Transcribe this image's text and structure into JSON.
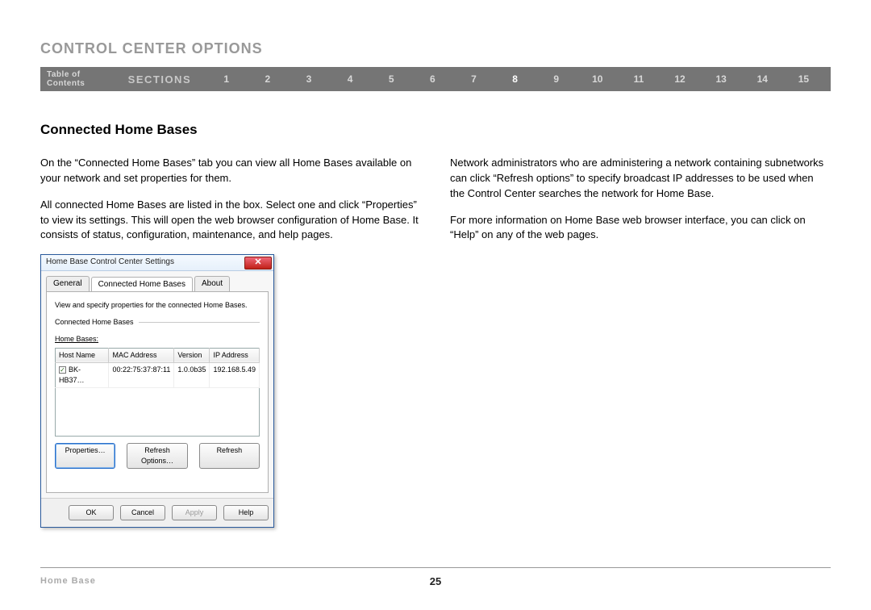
{
  "header": {
    "title": "CONTROL CENTER OPTIONS"
  },
  "nav": {
    "toc": "Table of Contents",
    "sections_label": "SECTIONS",
    "numbers": [
      "1",
      "2",
      "3",
      "4",
      "5",
      "6",
      "7",
      "8",
      "9",
      "10",
      "11",
      "12",
      "13",
      "14",
      "15"
    ],
    "current": "8"
  },
  "subheading": "Connected Home Bases",
  "body": {
    "left_paragraphs": [
      "On the “Connected Home Bases” tab you can view all Home Bases available on your network and set properties for them.",
      "All connected Home Bases are listed in the box. Select one and click “Properties” to view its settings. This will open the web browser configuration of Home Base. It consists of status, configuration, maintenance, and help pages."
    ],
    "right_paragraphs": [
      "Network administrators who are administering a network containing subnetworks can click “Refresh options” to specify broadcast IP addresses to be used when the Control Center searches the network for Home Base.",
      "For more information on Home Base web browser interface, you can click on “Help” on any of the web pages."
    ]
  },
  "dialog": {
    "title": "Home Base Control Center Settings",
    "tabs": [
      "General",
      "Connected Home Bases",
      "About"
    ],
    "active_tab": "Connected Home Bases",
    "panel_desc": "View and specify properties for the connected Home Bases.",
    "fieldset_legend": "Connected Home Bases",
    "list_label": "Home Bases:",
    "columns": [
      "Host Name",
      "MAC Address",
      "Version",
      "IP Address"
    ],
    "rows": [
      {
        "checked": true,
        "host": "BK-HB37…",
        "mac": "00:22:75:37:87:11",
        "version": "1.0.0b35",
        "ip": "192.168.5.49"
      }
    ],
    "panel_buttons": {
      "properties": "Properties…",
      "refresh_options": "Refresh Options…",
      "refresh": "Refresh"
    },
    "footer_buttons": {
      "ok": "OK",
      "cancel": "Cancel",
      "apply": "Apply",
      "help": "Help"
    }
  },
  "footer": {
    "left": "Home Base",
    "page_number": "25"
  }
}
